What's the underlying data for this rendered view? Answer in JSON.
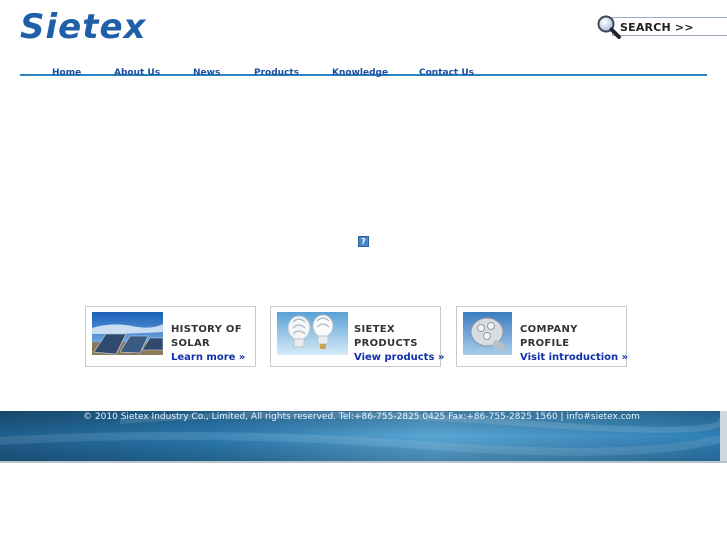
{
  "brand": {
    "logo_text": "Sietex",
    "colors": {
      "logo": "#1f5fa8",
      "nav": "#1a4f9e",
      "line": "#2b84c4",
      "link": "#1030a8"
    }
  },
  "search": {
    "label": "SEARCH >>",
    "icon": "magnifier-icon"
  },
  "nav": {
    "items": [
      "Home",
      "About Us",
      "News",
      "Products",
      "Knowledge",
      "Contact Us"
    ]
  },
  "flash": {
    "placeholder": "?"
  },
  "cards": [
    {
      "title_line1": "HISTORY OF",
      "title_line2": "SOLAR",
      "link": "Learn more »",
      "image": "solar-panels-image"
    },
    {
      "title_line1": "SIETEX",
      "title_line2": "PRODUCTS",
      "link": "View products »",
      "image": "cfl-bulbs-image"
    },
    {
      "title_line1": "COMPANY",
      "title_line2": "PROFILE",
      "link": "Visit introduction »",
      "image": "led-spotlight-image"
    }
  ],
  "footer": {
    "text": "© 2010 Sietex Industry Co., Limited, All rights reserved. Tel:+86-755-2825 0425 Fax:+86-755-2825 1560 | info#sietex.com"
  }
}
